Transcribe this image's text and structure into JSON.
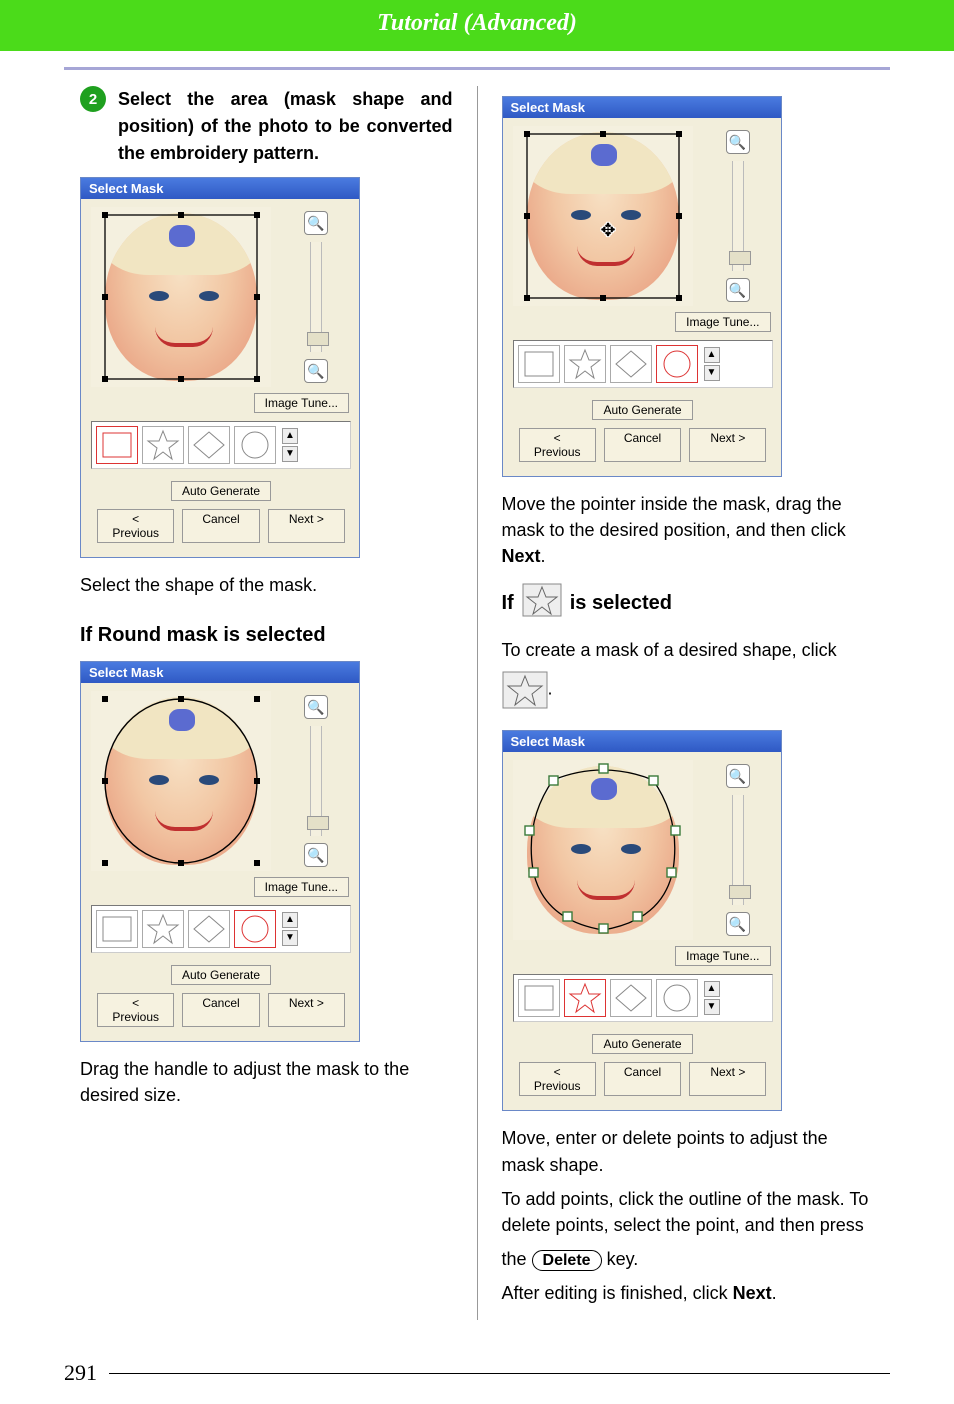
{
  "header": {
    "title": "Tutorial (Advanced)"
  },
  "step": {
    "number": "2",
    "text": "Select the area (mask shape and position) of the photo to be converted the embroidery pattern."
  },
  "left": {
    "caption1": "Select the shape of the mask.",
    "subhead": "If Round mask is selected",
    "caption2": "Drag the handle to adjust the mask to the desired size."
  },
  "right": {
    "caption1_a": "Move the pointer inside the mask, drag the mask to the desired position, and then click ",
    "caption1_b_bold": "Next",
    "caption1_c": ".",
    "if_prefix": "If",
    "if_suffix": " is selected",
    "caption2": "To create a mask of a desired shape, click ",
    "caption2_end": ".",
    "caption3": "Move, enter or delete points to adjust the mask shape.",
    "caption4": "To add points, click the outline of the mask. To delete points, select the point, and then press",
    "the_word": "the ",
    "delete_key": "Delete",
    "key_word": " key.",
    "caption5_a": "After editing is finished, click ",
    "caption5_b_bold": "Next",
    "caption5_c": "."
  },
  "dialog": {
    "title": "Select Mask",
    "image_tune": "Image Tune...",
    "auto_generate": "Auto Generate",
    "previous": "< Previous",
    "cancel": "Cancel",
    "next": "Next >",
    "zoom_in": "+",
    "zoom_out": "−",
    "scroll_up": "▲",
    "scroll_down": "▼"
  },
  "page_number": "291"
}
